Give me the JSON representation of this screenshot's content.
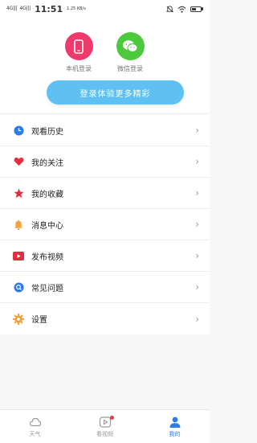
{
  "status_bar": {
    "signal_1": "4G|||",
    "signal_2": "4G|||",
    "time": "11:51",
    "speed": "1.25 KB/s",
    "battery_level": 0.3
  },
  "login": {
    "phone_label": "本机登录",
    "wechat_label": "微信登录",
    "button_label": "登录体验更多精彩",
    "phone_color": "#ef3a6b",
    "wechat_color": "#4cc93d",
    "button_color": "#5fc1f2"
  },
  "menu": [
    {
      "label": "观看历史",
      "icon": "clock-icon",
      "color": "#2e7be3"
    },
    {
      "label": "我的关注",
      "icon": "heart-icon",
      "color": "#e0303d"
    },
    {
      "label": "我的收藏",
      "icon": "star-icon",
      "color": "#e0303d"
    },
    {
      "label": "消息中心",
      "icon": "bell-icon",
      "color": "#f2a23b"
    },
    {
      "label": "发布视频",
      "icon": "video-icon",
      "color": "#e0303d"
    },
    {
      "label": "常见问题",
      "icon": "question-icon",
      "color": "#2e7be3"
    },
    {
      "label": "设置",
      "icon": "gear-icon",
      "color": "#f2a23b"
    }
  ],
  "tabbar": {
    "tabs": [
      {
        "label": "天气",
        "icon": "cloud-icon",
        "active": false
      },
      {
        "label": "看视频",
        "icon": "play-icon",
        "active": false
      },
      {
        "label": "我的",
        "icon": "user-icon",
        "active": true
      }
    ],
    "active_color": "#2d7ee8"
  }
}
